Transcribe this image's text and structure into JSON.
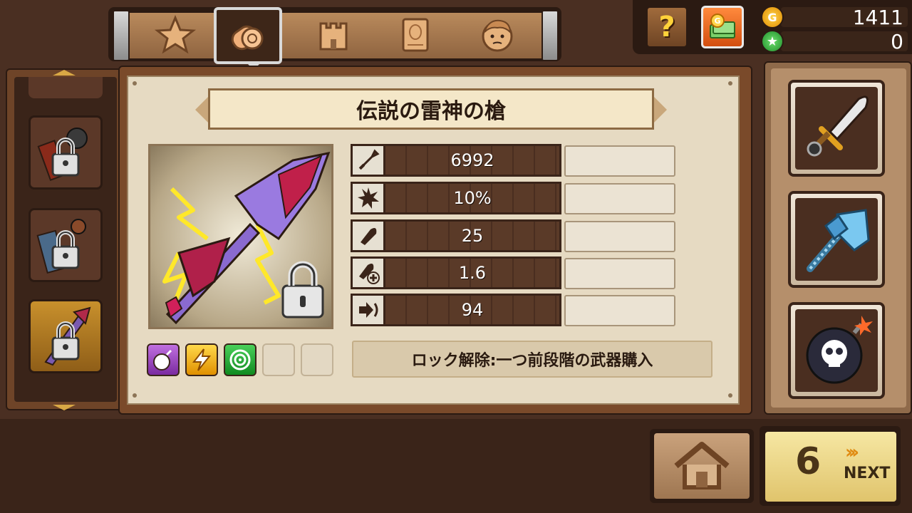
{
  "tabs": [
    {
      "name": "star-tab",
      "icon": "star-icon",
      "active": false
    },
    {
      "name": "cannon-tab",
      "icon": "cannon-icon",
      "active": true
    },
    {
      "name": "castle-tab",
      "icon": "castle-icon",
      "active": false
    },
    {
      "name": "scroll-tab",
      "icon": "scroll-icon",
      "active": false
    },
    {
      "name": "hero-tab",
      "icon": "hero-face-icon",
      "active": false
    }
  ],
  "currency": {
    "gold_symbol": "G",
    "gold": "1411",
    "star_symbol": "★",
    "stars": "0"
  },
  "help_label": "?",
  "weapon": {
    "title": "伝説の雷神の槍",
    "stats": [
      {
        "icon": "attack-icon",
        "value": "6992"
      },
      {
        "icon": "critical-icon",
        "value": "10%"
      },
      {
        "icon": "bullet-icon",
        "value": "25"
      },
      {
        "icon": "bullet-speed-icon",
        "value": "1.6"
      },
      {
        "icon": "range-icon",
        "value": "94"
      }
    ],
    "skills": [
      "bomb-skill-icon",
      "lightning-skill-icon",
      "target-skill-icon"
    ],
    "unlock_text": "ロック解除:一つ前段階の武器購入",
    "locked": true
  },
  "side_weapons": [
    "sword-icon",
    "ice-axe-icon",
    "skull-bomb-icon"
  ],
  "next": {
    "count": "6",
    "label": "NEXT",
    "chevrons": "›››"
  },
  "colors": {
    "gold": "#ffd54a",
    "accent_orange": "#e08a10",
    "parchment": "#e6dac2",
    "wood_dark": "#3a2419"
  }
}
